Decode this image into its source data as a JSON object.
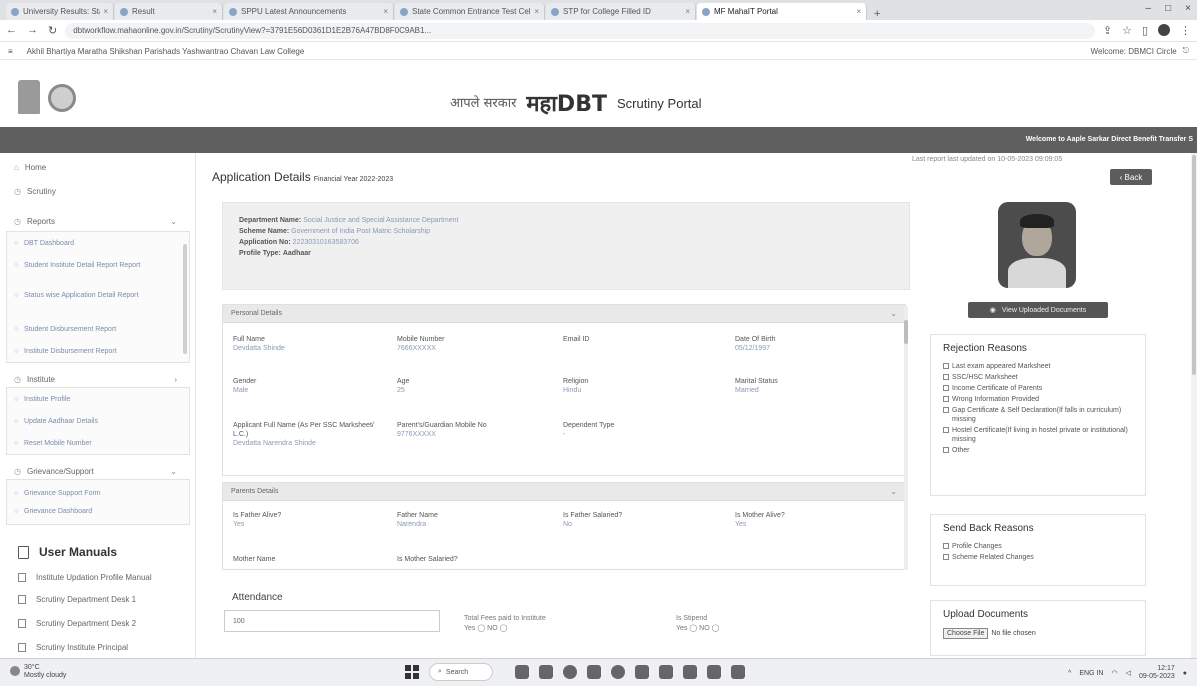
{
  "browser": {
    "tabs": [
      {
        "label": "University Results: State Online",
        "active": false
      },
      {
        "label": "Result",
        "active": false
      },
      {
        "label": "SPPU Latest Announcements",
        "active": false
      },
      {
        "label": "State Common Entrance Test Cell",
        "active": false
      },
      {
        "label": "STP for College Filled ID",
        "active": false
      },
      {
        "label": "MF MahaIT Portal",
        "active": true
      }
    ],
    "url": "dbtworkflow.mahaonline.gov.in/Scrutiny/ScrutinyView?=3791E56D0361D1E2B76A47BD8F0C9AB1..."
  },
  "bookmark_bar": {
    "college": "Akhil Bhartiya Maratha Shikshan Parishads Yashwantrao Chavan Law College",
    "welcome": "Welcome: DBMCI Circle"
  },
  "header": {
    "hindi_tagline": "आपले सरकार",
    "maha": "महाDBT",
    "portal": "Scrutiny Portal",
    "welcome_strip": "Welcome to Aaple Sarkar Direct Benefit Transfer S"
  },
  "sidebar": {
    "home": "Home",
    "scrutiny": "Scrutiny",
    "reports": "Reports",
    "report_items": [
      "DBT Dashboard",
      "Student Institute Detail Report Report",
      "Status wise Application Detail Report",
      "Student Disbursement Report",
      "Institute Disbursement Report"
    ],
    "institute": "Institute",
    "institute_items": [
      "Institute Profile",
      "Update Aadhaar Details",
      "Reset Mobile Number"
    ],
    "grievance": "Grievance/Support",
    "grievance_items": [
      "Grievance Support Form",
      "Grievance Dashboard"
    ],
    "user_manuals": "User Manuals",
    "manuals": [
      "Institute Updation Profile Manual",
      "Scrutiny Department Desk 1",
      "Scrutiny Department Desk 2",
      "Scrutiny Institute Principal"
    ]
  },
  "main": {
    "title": "Application Details",
    "financial_year": "Financial Year 2022-2023",
    "last_updated": "Last report last updated on 10-05-2023 09:09:05",
    "back_label": "Back",
    "dept": {
      "department_label": "Department Name:",
      "department_value": "Social Justice and Special Assistance Department",
      "scheme_label": "Scheme Name:",
      "scheme_value": "Government of India Post Matric Scholarship",
      "application_label": "Application No:",
      "application_value": "22230310163583706",
      "profile_label": "Profile Type:",
      "profile_value": "Aadhaar"
    },
    "personal": {
      "header": "Personal Details",
      "full_name_label": "Full Name",
      "full_name_value": "Devdatta Shinde",
      "mobile_label": "Mobile Number",
      "mobile_value": "7666XXXXX",
      "email_label": "Email ID",
      "email_value": "",
      "dob_label": "Date Of Birth",
      "dob_value": "05/12/1997",
      "gender_label": "Gender",
      "gender_value": "Male",
      "age_label": "Age",
      "age_value": "25",
      "religion_label": "Religion",
      "religion_value": "Hindu",
      "marital_label": "Marital Status",
      "marital_value": "Married",
      "applicant_label": "Applicant Full Name (As Per SSC Marksheet/ L.C.)",
      "applicant_value": "Devdatta Narendra Shinde",
      "parent_mobile_label": "Parent's/Guardian Mobile No",
      "parent_mobile_value": "9776XXXXX",
      "dependent_label": "Dependent Type",
      "dependent_value": "-"
    },
    "parents": {
      "header": "Parents Details",
      "father_alive_label": "Is Father Alive?",
      "father_alive_value": "Yes",
      "father_name_label": "Father Name",
      "father_name_value": "Narendra",
      "father_salaried_label": "Is Father Salaried?",
      "father_salaried_value": "No",
      "mother_alive_label": "Is Mother Alive?",
      "mother_alive_value": "Yes",
      "mother_name_label": "Mother Name",
      "mother_salaried_label": "Is Mother Salaried?"
    },
    "attendance": {
      "label": "Attendance",
      "value": "100",
      "fee_q": "Total Fees paid to Institute",
      "fee_opts": "Yes ◯ NO ◯",
      "stipend_q": "Is Stipend",
      "stipend_opts": "Yes ◯ NO ◯"
    }
  },
  "right": {
    "view_docs": "View Uploaded Documents",
    "rejection_title": "Rejection Reasons",
    "rejection_items": [
      "Last exam appeared Marksheet",
      "SSC/HSC Marksheet",
      "Income Certificate of Parents",
      "Wrong Information Provided",
      "Gap Certificate & Self Declaration(If falls in curriculum) missing",
      "Hostel Certificate(If living in hostel private or institutional) missing",
      "Other"
    ],
    "sendback_title": "Send Back Reasons",
    "sendback_items": [
      "Profile Changes",
      "Scheme Related Changes"
    ],
    "upload_title": "Upload Documents",
    "choose_file": "Choose File",
    "no_file": "No file chosen"
  },
  "taskbar": {
    "temp": "30°C",
    "weather": "Mostly cloudy",
    "search": "Search",
    "lang": "ENG IN",
    "time": "12:17",
    "date": "09-05-2023"
  }
}
